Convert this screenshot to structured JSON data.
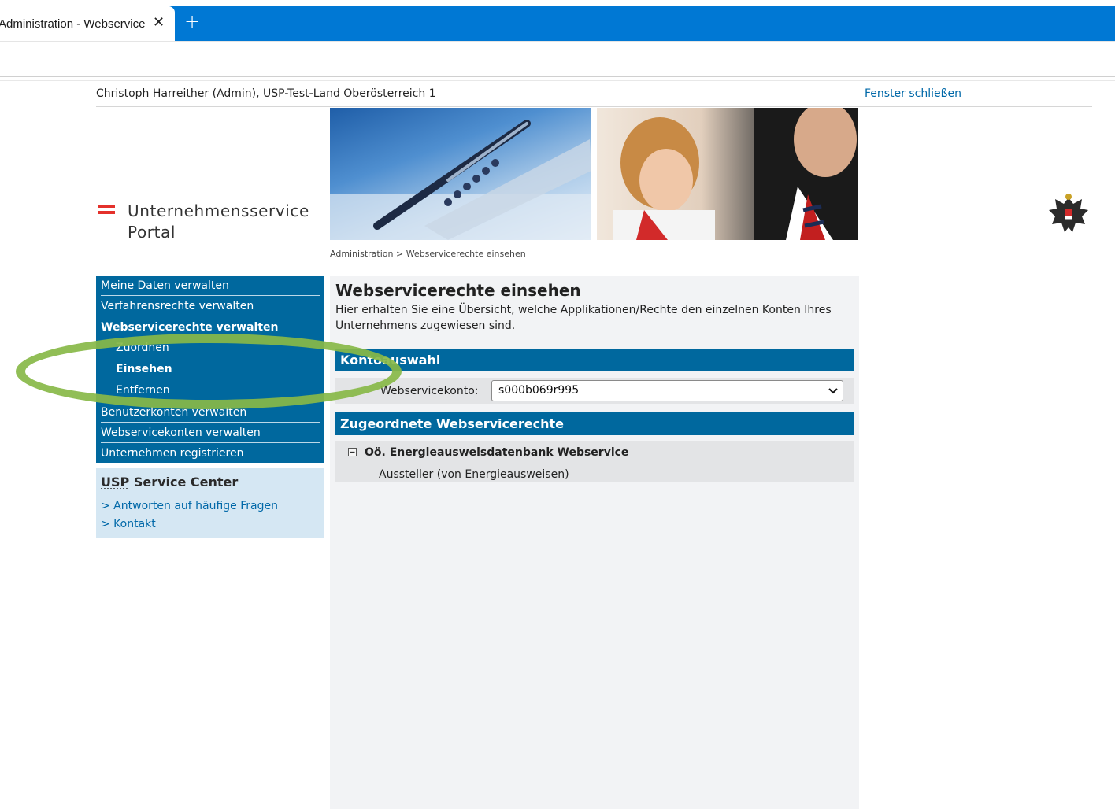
{
  "browser": {
    "tab_title": "Administration - Webservicerechte einsehen",
    "tab_close": "✕",
    "new_tab": "+"
  },
  "header": {
    "user_info": "Christoph Harreither (Admin), USP-Test-Land Oberösterreich 1",
    "close_window": "Fenster schließen",
    "logo_line1": "Unternehmensservice",
    "logo_line2": "Portal"
  },
  "breadcrumb": "Administration > Webservicerechte einsehen",
  "nav": {
    "items": [
      {
        "label": "Meine Daten verwalten"
      },
      {
        "label": "Verfahrensrechte verwalten"
      },
      {
        "label": "Webservicerechte verwalten"
      },
      {
        "label": "Benutzerkonten verwalten"
      },
      {
        "label": "Webservicekonten verwalten"
      },
      {
        "label": "Unternehmen registrieren"
      }
    ],
    "subitems": [
      {
        "label": "Zuordnen"
      },
      {
        "label": "Einsehen"
      },
      {
        "label": "Entfernen"
      }
    ]
  },
  "service_center": {
    "title_abbr": "USP",
    "title_rest": " Service Center",
    "links": [
      {
        "label": "> Antworten auf häufige Fragen"
      },
      {
        "label": "> Kontakt"
      }
    ]
  },
  "main": {
    "title": "Webservicerechte einsehen",
    "description": "Hier erhalten Sie eine Übersicht, welche Applikationen/Rechte den einzelnen Konten Ihres Unternehmens zugewiesen sind.",
    "kontoauswahl": {
      "heading": "Kontoauswahl",
      "label": "Webservicekonto:",
      "selected": "s000b069r995"
    },
    "rights": {
      "heading": "Zugeordnete Webservicerechte",
      "toggle": "⊟",
      "application": "Oö. Energieausweisdatenbank Webservice",
      "role": "Aussteller (von Energieausweisen)"
    }
  },
  "colors": {
    "accent": "#00689e",
    "browser_blue": "#0078d4",
    "highlight": "#88b848",
    "service_bg": "#d5e7f3"
  }
}
